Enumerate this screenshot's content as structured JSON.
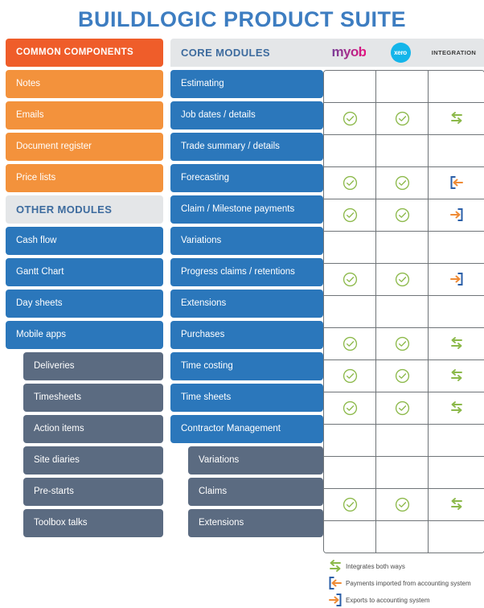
{
  "title": "BUILDLOGIC PRODUCT SUITE",
  "colors": {
    "title_blue": "#3d7dc1",
    "orange_head": "#ef5d2a",
    "orange": "#f3923c",
    "grey_head_bg": "#e4e6e8",
    "grey_head_text": "#3d6b9e",
    "blue": "#2b77bb",
    "slate": "#5b6b81",
    "check_green": "#8cb94a",
    "arrow_orange": "#ef8b35",
    "bracket_blue": "#2b5fa8",
    "grid_line": "#6f7478",
    "myob_purple": "#7b3f98",
    "myob_pink": "#e4127f",
    "xero_blue": "#13b5ea"
  },
  "sidebar": {
    "common_components_header": "COMMON COMPONENTS",
    "common_components": [
      {
        "label": "Notes"
      },
      {
        "label": "Emails"
      },
      {
        "label": "Document register"
      },
      {
        "label": "Price lists"
      }
    ],
    "other_modules_header": "OTHER MODULES",
    "other_modules": [
      {
        "label": "Cash flow",
        "style": "blue"
      },
      {
        "label": "Gantt Chart",
        "style": "blue"
      },
      {
        "label": "Day sheets",
        "style": "blue"
      },
      {
        "label": "Mobile apps",
        "style": "blue"
      },
      {
        "label": "Deliveries",
        "style": "slate-indent"
      },
      {
        "label": "Timesheets",
        "style": "slate-indent"
      },
      {
        "label": "Action items",
        "style": "slate-indent"
      },
      {
        "label": "Site diaries",
        "style": "slate-indent"
      },
      {
        "label": "Pre-starts",
        "style": "slate-indent"
      },
      {
        "label": "Toolbox talks",
        "style": "slate-indent"
      }
    ]
  },
  "matrix": {
    "header_label": "CORE MODULES",
    "columns": [
      {
        "key": "myob",
        "label": "myob",
        "type": "logo"
      },
      {
        "key": "xero",
        "label": "xero",
        "type": "logo"
      },
      {
        "key": "integration",
        "label": "INTEGRATION",
        "type": "text"
      }
    ],
    "rows": [
      {
        "label": "Estimating",
        "style": "blue",
        "myob": "",
        "xero": "",
        "integration": ""
      },
      {
        "label": "Job dates / details",
        "style": "blue",
        "myob": "check",
        "xero": "check",
        "integration": "both"
      },
      {
        "label": "Trade summary / details",
        "style": "blue",
        "myob": "",
        "xero": "",
        "integration": ""
      },
      {
        "label": "Forecasting",
        "style": "blue",
        "myob": "check",
        "xero": "check",
        "integration": "import"
      },
      {
        "label": "Claim / Milestone payments",
        "style": "blue",
        "myob": "check",
        "xero": "check",
        "integration": "export"
      },
      {
        "label": "Variations",
        "style": "blue",
        "myob": "",
        "xero": "",
        "integration": ""
      },
      {
        "label": "Progress claims / retentions",
        "style": "blue",
        "myob": "check",
        "xero": "check",
        "integration": "export"
      },
      {
        "label": "Extensions",
        "style": "blue",
        "myob": "",
        "xero": "",
        "integration": ""
      },
      {
        "label": "Purchases",
        "style": "blue",
        "myob": "check",
        "xero": "check",
        "integration": "both"
      },
      {
        "label": "Time costing",
        "style": "blue",
        "myob": "check",
        "xero": "check",
        "integration": "both"
      },
      {
        "label": "Time sheets",
        "style": "blue",
        "myob": "check",
        "xero": "check",
        "integration": "both"
      },
      {
        "label": "Contractor Management",
        "style": "blue",
        "myob": "",
        "xero": "",
        "integration": ""
      },
      {
        "label": "Variations",
        "style": "slate-indent",
        "myob": "",
        "xero": "",
        "integration": ""
      },
      {
        "label": "Claims",
        "style": "slate-indent",
        "myob": "check",
        "xero": "check",
        "integration": "both"
      },
      {
        "label": "Extensions",
        "style": "slate-indent",
        "myob": "",
        "xero": "",
        "integration": ""
      }
    ]
  },
  "legend": [
    {
      "icon": "both",
      "text": "Integrates both ways"
    },
    {
      "icon": "import",
      "text": "Payments imported from accounting system"
    },
    {
      "icon": "export",
      "text": "Exports to accounting system"
    }
  ]
}
